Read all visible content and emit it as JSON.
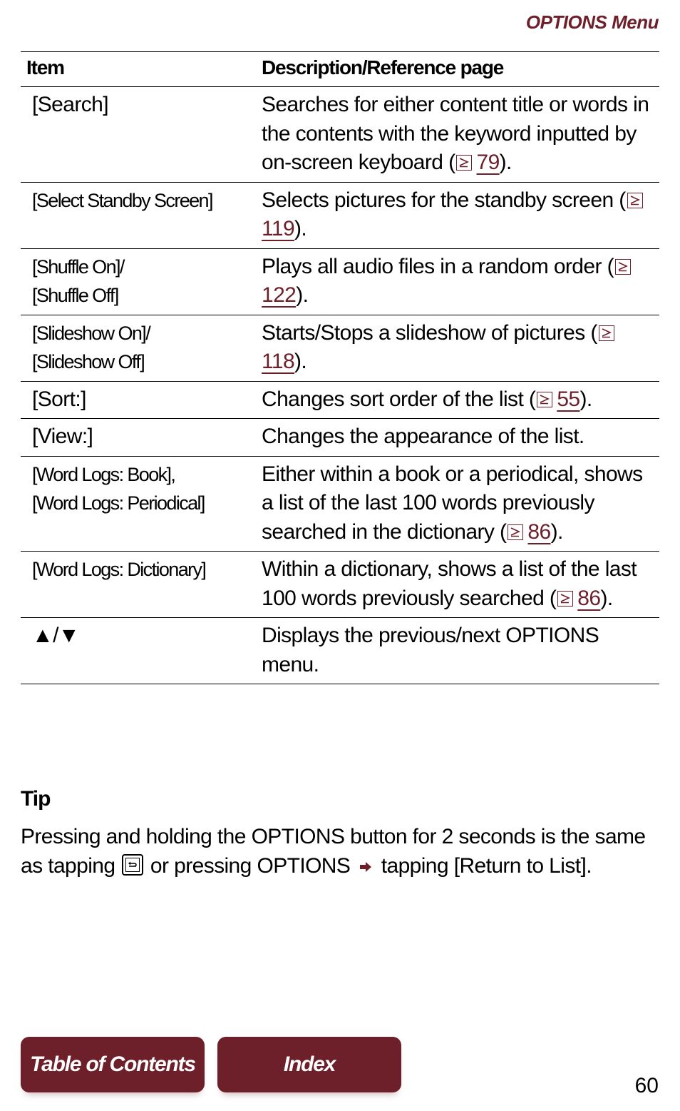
{
  "header": {
    "title": "OPTIONS Menu"
  },
  "table": {
    "columns": [
      "Item",
      "Description/Reference page"
    ],
    "rows": [
      {
        "item": "[Search]",
        "desc": "Searches for either content title or words in the contents with the keyword inputted by on-screen keyboard (",
        "ref": "79",
        "after": ")."
      },
      {
        "item": "[Select Standby Screen]",
        "desc": "Selects pictures for the standby screen (",
        "ref": "119",
        "after": ")."
      },
      {
        "item": "[Shuffle On]/\n[Shuffle Off]",
        "desc": "Plays all audio files in a random order (",
        "ref": "122",
        "after": ")."
      },
      {
        "item": "[Slideshow On]/\n[Slideshow Off]",
        "desc": "Starts/Stops a slideshow of pictures (",
        "ref": "118",
        "after": ")."
      },
      {
        "item": "[Sort:]",
        "desc": "Changes sort order of the list (",
        "ref": "55",
        "after": ")."
      },
      {
        "item": "[View:]",
        "desc": "Changes the appearance of the list.",
        "ref": null,
        "after": ""
      },
      {
        "item": "[Word Logs: Book],\n[Word Logs: Periodical]",
        "desc": "Either within a book or a periodical, shows a list of the last 100 words previously searched in the dictionary (",
        "ref": "86",
        "after": ")."
      },
      {
        "item": "[Word Logs: Dictionary]",
        "desc": "Within a dictionary, shows a list of the last 100 words previously searched (",
        "ref": "86",
        "after": ")."
      },
      {
        "item": "▲/▼",
        "desc": "Displays the previous/next OPTIONS menu.",
        "ref": null,
        "after": ""
      }
    ]
  },
  "tip": {
    "heading": "Tip",
    "part1": "Pressing and holding the OPTIONS button for 2 seconds is the same as tapping ",
    "icon": "return-icon",
    "part2": " or pressing OPTIONS ",
    "arrow": "arrow-right-icon",
    "part3": " tapping [Return to List]."
  },
  "nav": {
    "toc_label": "Table of Contents",
    "index_label": "Index"
  },
  "page_number": "60",
  "colors": {
    "accent": "#6d1f2a",
    "button": "#6d2029"
  }
}
